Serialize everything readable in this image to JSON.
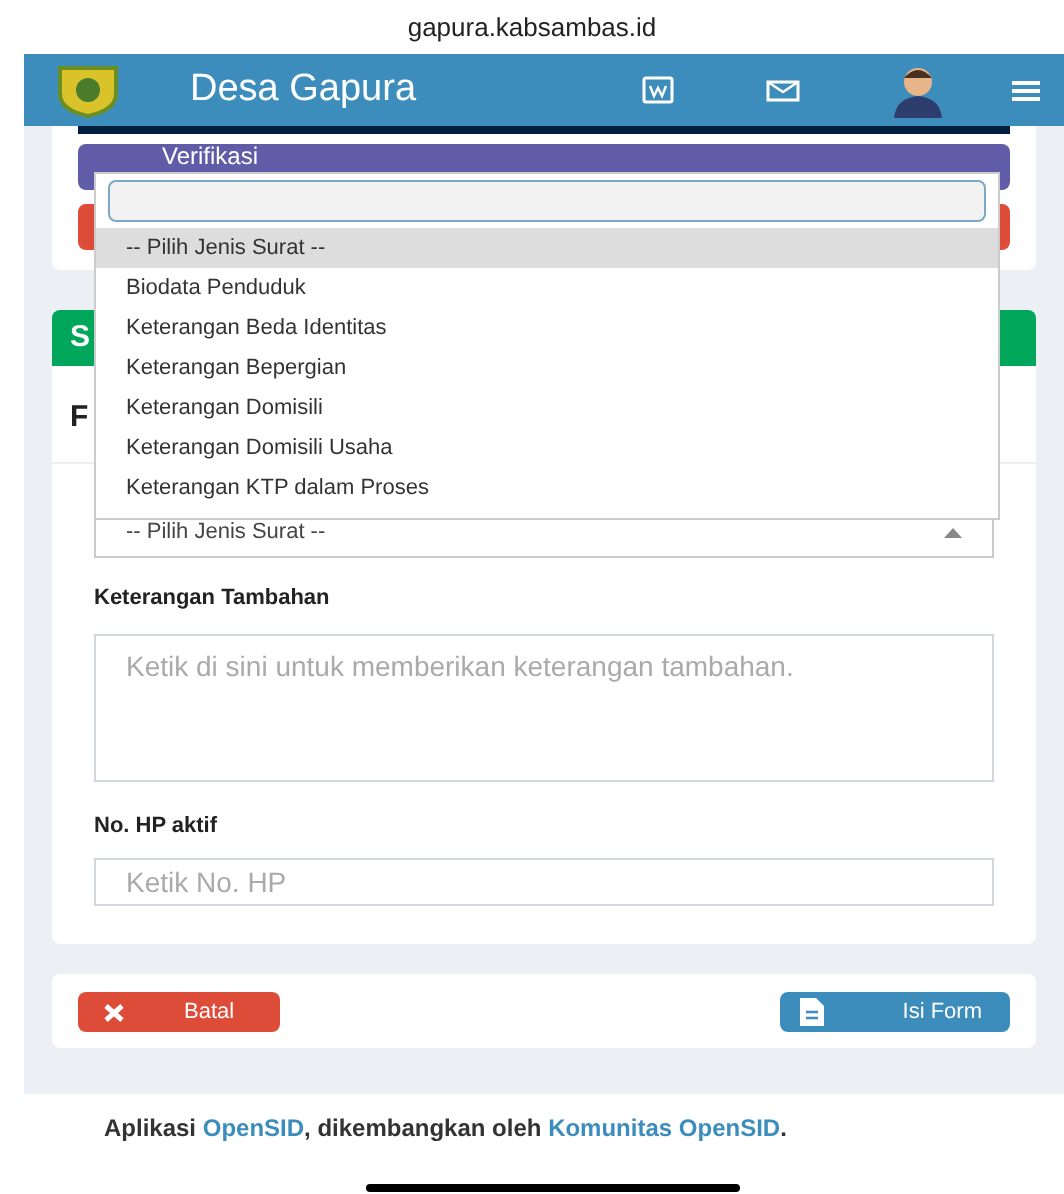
{
  "browser": {
    "url": "gapura.kabsambas.id"
  },
  "header": {
    "title": "Desa Gapura"
  },
  "top_buttons": [
    {
      "label": "Verifikasi",
      "color": "#605ca8"
    },
    {
      "color": "#dd4b39"
    }
  ],
  "section": {
    "header": "S",
    "form_title": "F"
  },
  "dropdown": {
    "open": true,
    "options": [
      {
        "label": "-- Pilih Jenis Surat --",
        "selected": true
      },
      {
        "label": "Biodata Penduduk",
        "selected": false
      },
      {
        "label": "Keterangan Beda Identitas",
        "selected": false
      },
      {
        "label": "Keterangan Bepergian",
        "selected": false
      },
      {
        "label": "Keterangan Domisili",
        "selected": false
      },
      {
        "label": "Keterangan Domisili Usaha",
        "selected": false
      },
      {
        "label": "Keterangan KTP dalam Proses",
        "selected": false
      }
    ]
  },
  "select": {
    "value": "-- Pilih Jenis Surat --"
  },
  "fields": [
    {
      "label": "Keterangan Tambahan",
      "placeholder": "Ketik di sini untuk memberikan keterangan tambahan.",
      "kind": "textarea"
    },
    {
      "label": "No. HP aktif",
      "placeholder": "Ketik No. HP",
      "kind": "input"
    }
  ],
  "buttons": [
    {
      "label": "Batal",
      "kind": "cancel"
    },
    {
      "label": "Isi Form",
      "kind": "submit"
    }
  ],
  "footer": [
    {
      "text": "Aplikasi ",
      "kind": "text"
    },
    {
      "text": "OpenSID",
      "kind": "link"
    },
    {
      "text": ", dikembangkan oleh ",
      "kind": "text"
    },
    {
      "text": "Komunitas OpenSID",
      "kind": "link"
    },
    {
      "text": ".",
      "kind": "text"
    }
  ]
}
